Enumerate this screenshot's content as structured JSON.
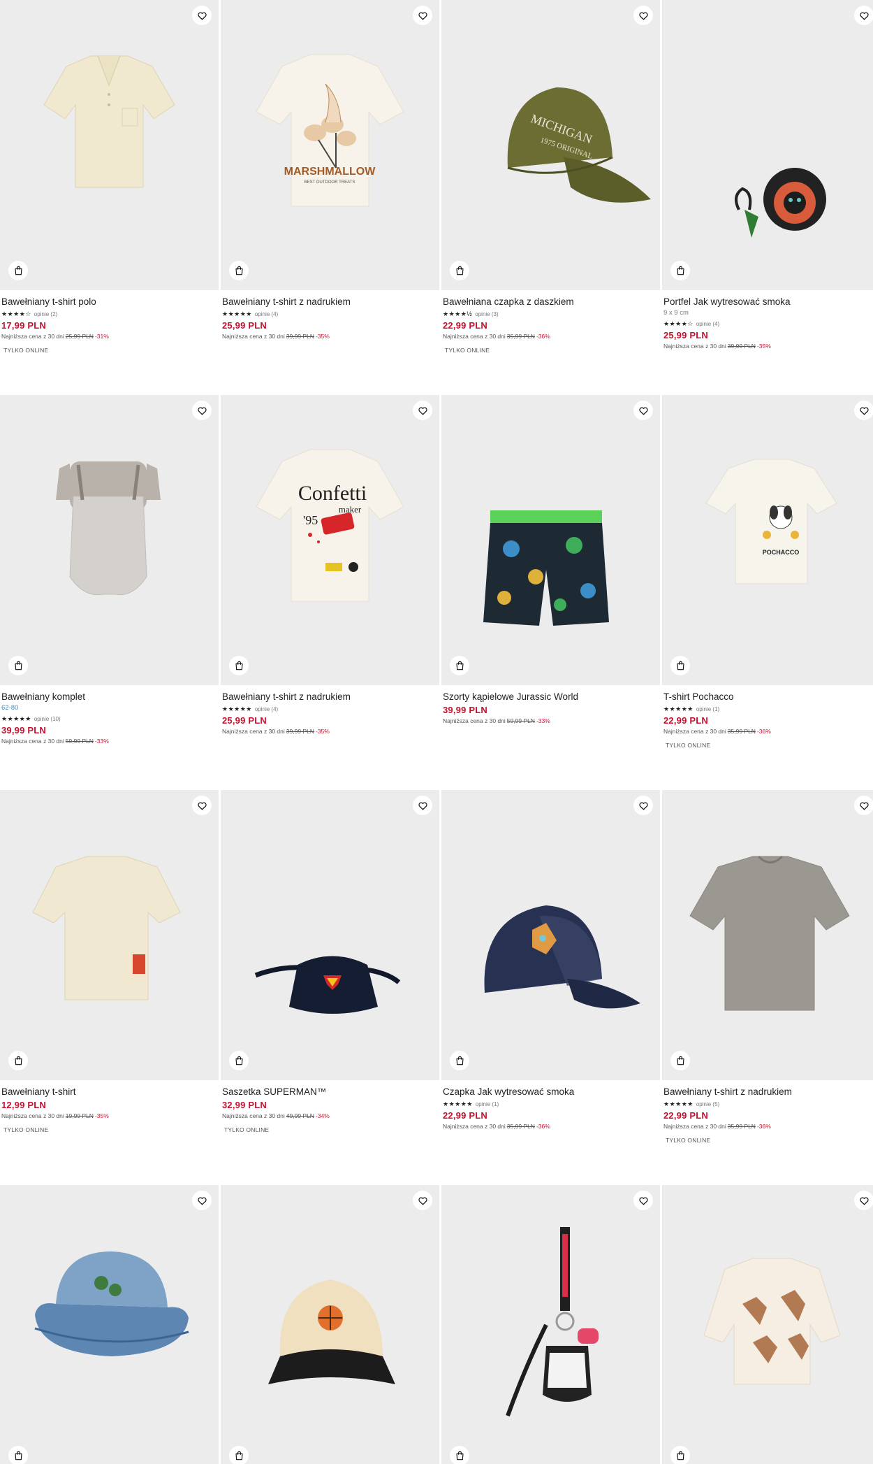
{
  "labels": {
    "lowest_prefix": "Najniższa cena z 30 dni",
    "online_only": "TYLKO ONLINE"
  },
  "icons": {
    "favorite": "heart-icon",
    "cart": "shopping-bag-icon",
    "rating": "star-icon"
  },
  "colors": {
    "price": "#c8102e",
    "variant_link": "#3a8fc1",
    "tile_background": "#ececed"
  },
  "products": [
    {
      "name": "Bawełniany t-shirt polo",
      "stars": "★★★★☆",
      "reviews": "opinie (2)",
      "price": "17,99 PLN",
      "old_price": "25,99 PLN",
      "discount": "-31%",
      "online_only": true
    },
    {
      "name": "Bawełniany t-shirt z nadrukiem",
      "stars": "★★★★★",
      "reviews": "opinie (4)",
      "price": "25,99 PLN",
      "old_price": "39,99 PLN",
      "discount": "-35%",
      "online_only": false
    },
    {
      "name": "Bawełniana czapka z daszkiem",
      "stars": "★★★★½",
      "reviews": "opinie (3)",
      "price": "22,99 PLN",
      "old_price": "35,99 PLN",
      "discount": "-36%",
      "online_only": true
    },
    {
      "name": "Portfel Jak wytresować smoka",
      "variant": "9 x 9 cm",
      "stars": "★★★★☆",
      "reviews": "opinie (4)",
      "price": "25,99 PLN",
      "old_price": "39,99 PLN",
      "discount": "-35%",
      "online_only": false
    },
    {
      "name": "Bawełniany komplet",
      "variant": "62-80",
      "variant_link": true,
      "stars": "★★★★★",
      "reviews": "opinie (10)",
      "price": "39,99 PLN",
      "old_price": "59,99 PLN",
      "discount": "-33%",
      "online_only": false
    },
    {
      "name": "Bawełniany t-shirt z nadrukiem",
      "stars": "★★★★★",
      "reviews": "opinie (4)",
      "price": "25,99 PLN",
      "old_price": "39,99 PLN",
      "discount": "-35%",
      "online_only": false
    },
    {
      "name": "Szorty kąpielowe Jurassic World",
      "price": "39,99 PLN",
      "old_price": "59,99 PLN",
      "discount": "-33%",
      "online_only": false
    },
    {
      "name": "T-shirt Pochacco",
      "stars": "★★★★★",
      "reviews": "opinie (1)",
      "price": "22,99 PLN",
      "old_price": "35,99 PLN",
      "discount": "-36%",
      "online_only": true
    },
    {
      "name": "Bawełniany t-shirt",
      "price": "12,99 PLN",
      "old_price": "19,99 PLN",
      "discount": "-35%",
      "online_only": true
    },
    {
      "name": "Saszetka SUPERMAN™",
      "price": "32,99 PLN",
      "old_price": "49,99 PLN",
      "discount": "-34%",
      "online_only": true
    },
    {
      "name": "Czapka Jak wytresować smoka",
      "stars": "★★★★★",
      "reviews": "opinie (1)",
      "price": "22,99 PLN",
      "old_price": "35,99 PLN",
      "discount": "-36%",
      "online_only": false
    },
    {
      "name": "Bawełniany t-shirt z nadrukiem",
      "stars": "★★★★★",
      "reviews": "opinie (5)",
      "price": "22,99 PLN",
      "old_price": "35,99 PLN",
      "discount": "-36%",
      "online_only": true
    },
    {
      "name": "",
      "online_only": false
    },
    {
      "name": "",
      "online_only": false
    },
    {
      "name": "",
      "online_only": false
    },
    {
      "name": "",
      "online_only": false
    }
  ],
  "artwork_text": {
    "marshmallow": "MARSHMALLOW",
    "marshmallow_sub": "BEST OUTDOOR TREATS",
    "cap_text": "MICHIGAN",
    "cap_sub": "1975 ORIGINAL",
    "confetti": "Confetti",
    "confetti_maker": "maker",
    "confetti_year": "'95",
    "pochacco": "POCHACCO"
  }
}
